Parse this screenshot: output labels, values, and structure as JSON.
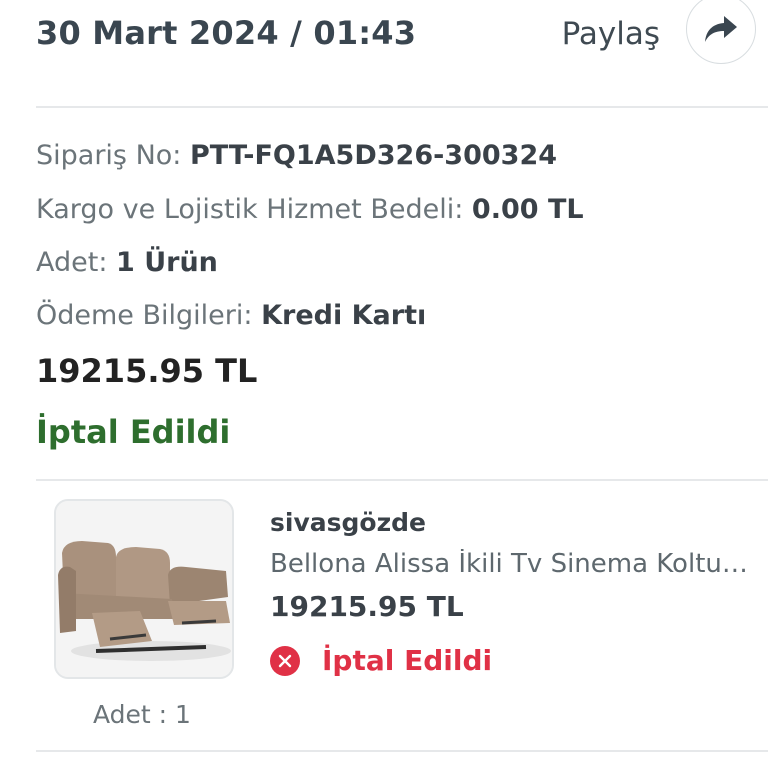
{
  "header": {
    "order_date": "30 Mart 2024 / 01:43",
    "share_label": "Paylaş",
    "share_icon": "share-arrow-icon"
  },
  "order_info": {
    "order_no_label": "Sipariş No:",
    "order_no_value": "PTT-FQ1A5D326-300324",
    "shipping_label": "Kargo ve Lojistik Hizmet Bedeli:",
    "shipping_value": "0.00 TL",
    "quantity_label": "Adet:",
    "quantity_value": "1 Ürün",
    "payment_label": "Ödeme Bilgileri:",
    "payment_value": "Kredi Kartı",
    "total": "19215.95 TL",
    "status": "İptal Edildi"
  },
  "product": {
    "seller": "sivasgözde",
    "name": "Bellona Alissa İkili Tv Sinema Koltuk Takımı",
    "price": "19215.95 TL",
    "status": "İptal Edildi",
    "quantity": "Adet : 1",
    "image_icon": "recliner-sofa-image"
  },
  "colors": {
    "status_cancelled_order": "#2e6e2e",
    "status_cancelled_item": "#e03146"
  }
}
